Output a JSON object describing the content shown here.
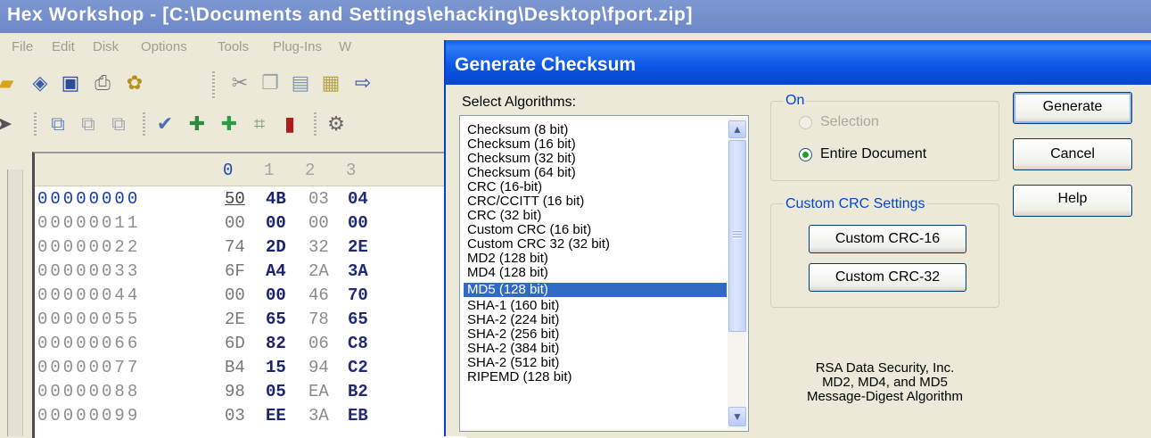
{
  "window": {
    "title": "Hex Workshop - [C:\\Documents and Settings\\ehacking\\Desktop\\fport.zip]"
  },
  "menu": {
    "items": [
      "File",
      "Edit",
      "Disk",
      "Options",
      "Tools",
      "Plug-Ins",
      "W"
    ]
  },
  "hex_editor": {
    "column_headers": [
      "0",
      "1",
      "2",
      "3"
    ],
    "rows": [
      {
        "address": "00000000",
        "bytes": [
          "50",
          "4B",
          "03",
          "04"
        ]
      },
      {
        "address": "00000011",
        "bytes": [
          "00",
          "00",
          "00",
          "00"
        ]
      },
      {
        "address": "00000022",
        "bytes": [
          "74",
          "2D",
          "32",
          "2E"
        ]
      },
      {
        "address": "00000033",
        "bytes": [
          "6F",
          "A4",
          "2A",
          "3A"
        ]
      },
      {
        "address": "00000044",
        "bytes": [
          "00",
          "00",
          "46",
          "70"
        ]
      },
      {
        "address": "00000055",
        "bytes": [
          "2E",
          "65",
          "78",
          "65"
        ]
      },
      {
        "address": "00000066",
        "bytes": [
          "6D",
          "82",
          "06",
          "C8"
        ]
      },
      {
        "address": "00000077",
        "bytes": [
          "B4",
          "15",
          "94",
          "C2"
        ]
      },
      {
        "address": "00000088",
        "bytes": [
          "98",
          "05",
          "EA",
          "B2"
        ]
      },
      {
        "address": "00000099",
        "bytes": [
          "03",
          "EE",
          "3A",
          "EB"
        ]
      }
    ]
  },
  "dialog": {
    "title": "Generate Checksum",
    "algorithms_label": "Select Algorithms:",
    "algorithms": [
      "Checksum (8 bit)",
      "Checksum (16 bit)",
      "Checksum (32 bit)",
      "Checksum (64 bit)",
      "CRC (16-bit)",
      "CRC/CCITT (16 bit)",
      "CRC (32 bit)",
      "Custom CRC (16 bit)",
      "Custom CRC 32 (32 bit)",
      "MD2 (128 bit)",
      "MD4 (128 bit)",
      "MD5 (128 bit)",
      "SHA-1 (160 bit)",
      "SHA-2 (224 bit)",
      "SHA-2 (256 bit)",
      "SHA-2 (384 bit)",
      "SHA-2 (512 bit)",
      "RIPEMD (128 bit)"
    ],
    "selected_algorithm": "MD5 (128 bit)",
    "on_group": {
      "legend": "On",
      "selection_label": "Selection",
      "entire_document_label": "Entire Document",
      "selected_option": "Entire Document"
    },
    "custom_crc_group": {
      "legend": "Custom CRC Settings",
      "crc16_label": "Custom CRC-16",
      "crc32_label": "Custom CRC-32"
    },
    "buttons": {
      "generate": "Generate",
      "cancel": "Cancel",
      "help": "Help"
    },
    "info_lines": [
      "RSA Data Security, Inc.",
      "MD2, MD4, and MD5",
      "Message-Digest Algorithm"
    ]
  },
  "colors": {
    "dialog_title_blue": "#0a55e4",
    "selection_blue": "#316ac5",
    "group_legend_blue": "#0046d5"
  }
}
